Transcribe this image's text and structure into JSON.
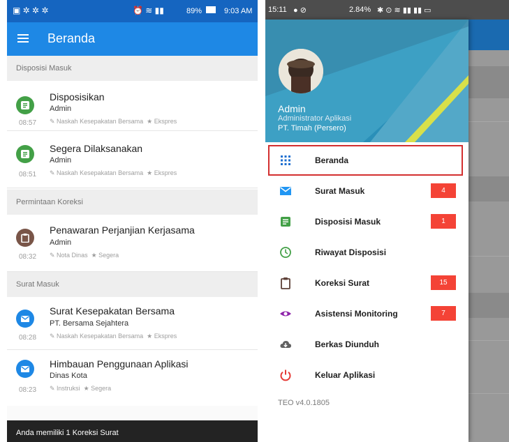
{
  "left": {
    "status": {
      "time": "9:03 AM",
      "battery": "89%"
    },
    "title": "Beranda",
    "sections": [
      {
        "label": "Disposisi Masuk"
      },
      {
        "label": "Permintaan Koreksi"
      },
      {
        "label": "Surat Masuk"
      }
    ],
    "items": [
      {
        "title": "Disposisikan",
        "sender": "Admin",
        "time": "08:57",
        "category": "Naskah Kesepakatan Bersama",
        "priority": "Ekspres",
        "icon": "document-icon",
        "color": "#43a047"
      },
      {
        "title": "Segera Dilaksanakan",
        "sender": "Admin",
        "time": "08:51",
        "category": "Naskah Kesepakatan Bersama",
        "priority": "Ekspres",
        "icon": "document-icon",
        "color": "#43a047"
      },
      {
        "title": "Penawaran Perjanjian Kerjasama",
        "sender": "Admin",
        "time": "08:32",
        "category": "Nota Dinas",
        "priority": "Segera",
        "icon": "clipboard-icon",
        "color": "#795548"
      },
      {
        "title": "Surat Kesepakatan Bersama",
        "sender": "PT. Bersama Sejahtera",
        "time": "08:28",
        "category": "Naskah Kesepakatan Bersama",
        "priority": "Ekspres",
        "icon": "mail-icon",
        "color": "#1e88e5"
      },
      {
        "title": "Himbauan Penggunaan Aplikasi",
        "sender": "Dinas Kota",
        "time": "08:23",
        "category": "Instruksi",
        "priority": "Segera",
        "icon": "mail-icon",
        "color": "#1e88e5"
      }
    ],
    "snackbar": "Anda memiliki 1 Koreksi Surat"
  },
  "right": {
    "status": {
      "time": "15:11",
      "info": "2.84% "
    },
    "user": {
      "name": "Admin",
      "role": "Administrator Aplikasi",
      "org": "PT. Timah (Persero)"
    },
    "nav": [
      {
        "label": "Beranda",
        "icon": "grid-icon",
        "badge": ""
      },
      {
        "label": "Surat Masuk",
        "icon": "mail-icon",
        "badge": "4"
      },
      {
        "label": "Disposisi Masuk",
        "icon": "document-icon",
        "badge": "1"
      },
      {
        "label": "Riwayat Disposisi",
        "icon": "clock-icon",
        "badge": ""
      },
      {
        "label": "Koreksi Surat",
        "icon": "clipboard-icon",
        "badge": "15"
      },
      {
        "label": "Asistensi Monitoring",
        "icon": "eye-icon",
        "badge": "7"
      },
      {
        "label": "Berkas Diunduh",
        "icon": "cloud-download-icon",
        "badge": ""
      },
      {
        "label": "Keluar Aplikasi",
        "icon": "power-icon",
        "badge": ""
      }
    ],
    "version": "TEO v4.0.1805"
  },
  "colors": {
    "appbar": "#1e88e5",
    "badge": "#f44336",
    "highlight": "#d32f2f"
  }
}
